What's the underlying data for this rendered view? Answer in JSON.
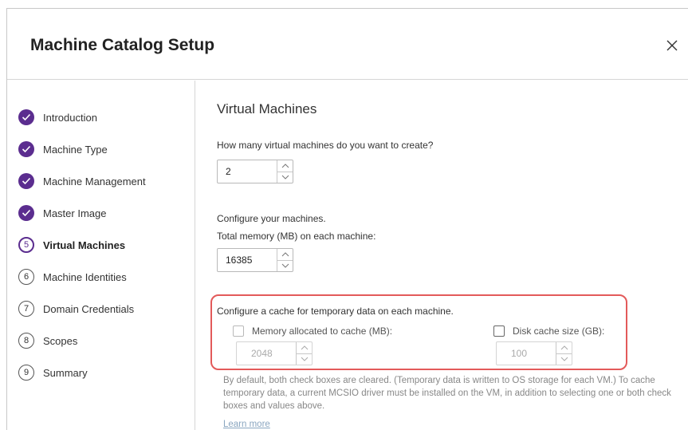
{
  "dialog": {
    "title": "Machine Catalog Setup"
  },
  "steps": [
    {
      "label": "Introduction",
      "state": "done",
      "number": ""
    },
    {
      "label": "Machine Type",
      "state": "done",
      "number": ""
    },
    {
      "label": "Machine Management",
      "state": "done",
      "number": ""
    },
    {
      "label": "Master Image",
      "state": "done",
      "number": ""
    },
    {
      "label": "Virtual Machines",
      "state": "current",
      "number": "5"
    },
    {
      "label": "Machine Identities",
      "state": "pending",
      "number": "6"
    },
    {
      "label": "Domain Credentials",
      "state": "pending",
      "number": "7"
    },
    {
      "label": "Scopes",
      "state": "pending",
      "number": "8"
    },
    {
      "label": "Summary",
      "state": "pending",
      "number": "9"
    }
  ],
  "main": {
    "section_title": "Virtual Machines",
    "vm_count_question": "How many virtual machines do you want to create?",
    "vm_count_value": "2",
    "configure_label": "Configure your machines.",
    "memory_label": "Total memory (MB) on each machine:",
    "memory_value": "16385",
    "cache": {
      "heading": "Configure a cache for temporary data on each machine.",
      "memory_cache_label": "Memory allocated to cache (MB):",
      "memory_cache_value": "2048",
      "disk_cache_label": "Disk cache size (GB):",
      "disk_cache_value": "100"
    },
    "help_text": "By default, both check boxes are cleared. (Temporary data is written to OS storage for each VM.) To cache temporary data, a current MCSIO driver must be installed on the VM, in addition to selecting one or both check boxes and values above.",
    "learn_more": "Learn more"
  },
  "colors": {
    "accent": "#5b2d8f",
    "highlight": "#e35a5a"
  }
}
